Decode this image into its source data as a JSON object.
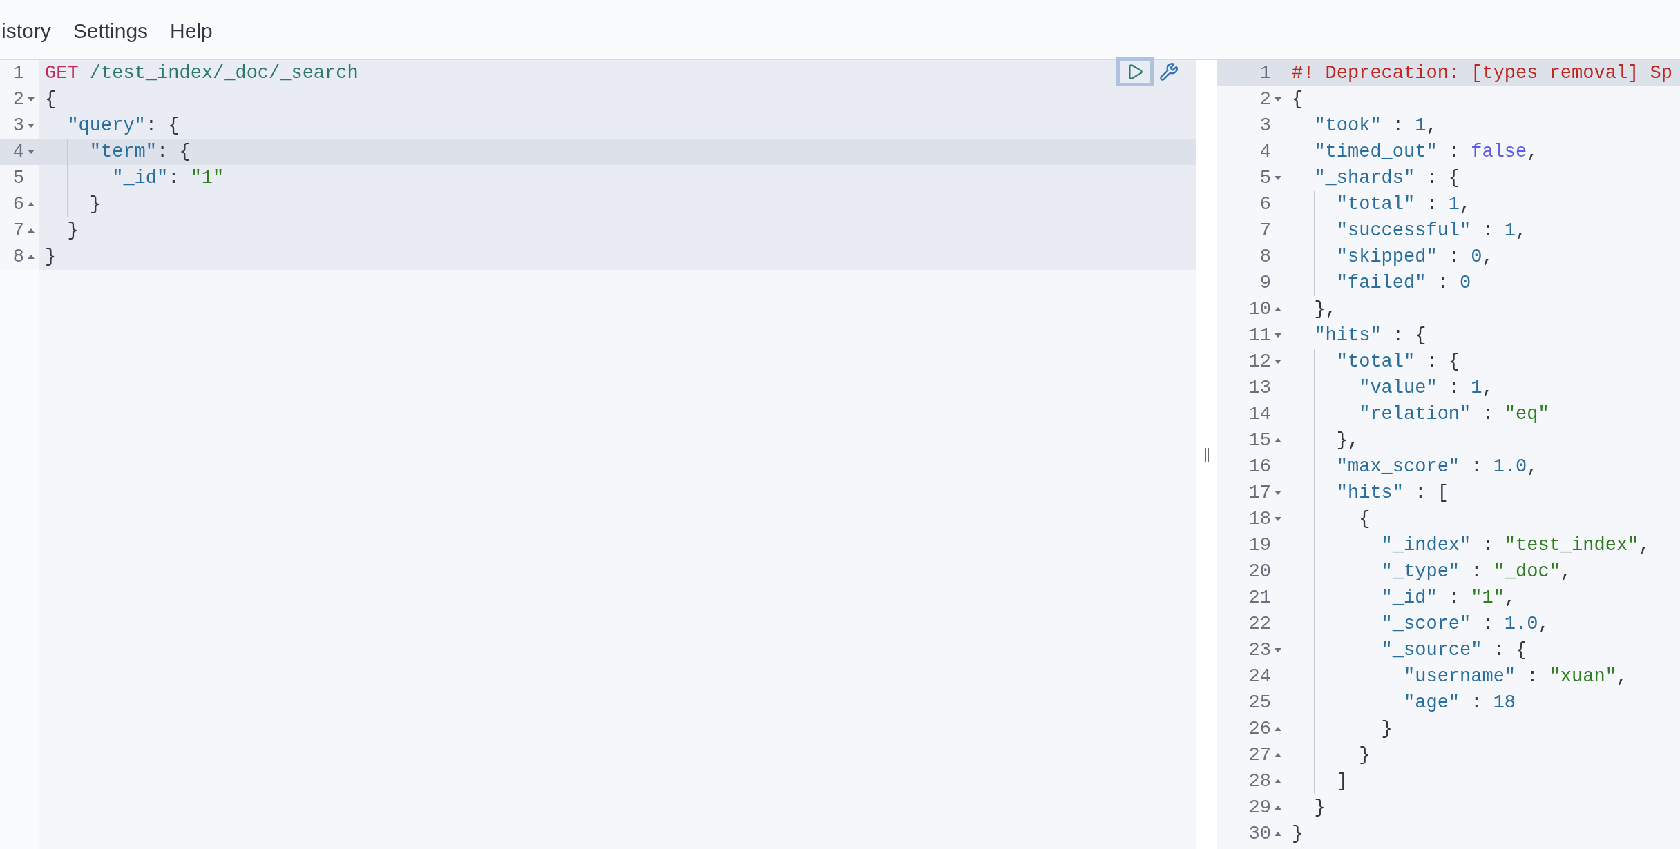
{
  "menu": [
    {
      "label": "istory"
    },
    {
      "label": "Settings"
    },
    {
      "label": "Help"
    }
  ],
  "request_editor": {
    "lines": [
      {
        "number": "1",
        "fold_start": false,
        "fold_end": false,
        "active": false,
        "highlighted": true,
        "tokens": [
          {
            "kind": "method",
            "text": "GET"
          },
          {
            "kind": "path",
            "text": " /test_index/_doc/_search"
          }
        ]
      },
      {
        "number": "2",
        "fold_start": true,
        "fold_end": false,
        "active": false,
        "highlighted": true,
        "tokens": [
          {
            "kind": "punct",
            "text": "{"
          }
        ]
      },
      {
        "number": "3",
        "fold_start": true,
        "fold_end": false,
        "active": false,
        "highlighted": true,
        "tokens": [
          {
            "kind": "key",
            "text": "  \"query\""
          },
          {
            "kind": "punct",
            "text": ": {"
          }
        ]
      },
      {
        "number": "4",
        "fold_start": true,
        "fold_end": false,
        "active": true,
        "highlighted": true,
        "tokens": [
          {
            "kind": "key",
            "text": "    \"term\""
          },
          {
            "kind": "punct",
            "text": ": {"
          }
        ]
      },
      {
        "number": "5",
        "fold_start": false,
        "fold_end": false,
        "active": false,
        "highlighted": true,
        "tokens": [
          {
            "kind": "key",
            "text": "      \"_id\""
          },
          {
            "kind": "punct",
            "text": ": "
          },
          {
            "kind": "string",
            "text": "\"1\""
          }
        ]
      },
      {
        "number": "6",
        "fold_start": false,
        "fold_end": true,
        "active": false,
        "highlighted": true,
        "tokens": [
          {
            "kind": "punct",
            "text": "    }"
          }
        ]
      },
      {
        "number": "7",
        "fold_start": false,
        "fold_end": true,
        "active": false,
        "highlighted": true,
        "tokens": [
          {
            "kind": "punct",
            "text": "  }"
          }
        ]
      },
      {
        "number": "8",
        "fold_start": false,
        "fold_end": true,
        "active": false,
        "highlighted": true,
        "tokens": [
          {
            "kind": "punct",
            "text": "}"
          }
        ]
      }
    ]
  },
  "response_viewer": {
    "lines": [
      {
        "number": "1",
        "fold_start": false,
        "fold_end": false,
        "active": true,
        "tokens": [
          {
            "kind": "comment",
            "text": "#! Deprecation: [types removal] Sp"
          }
        ]
      },
      {
        "number": "2",
        "fold_start": true,
        "fold_end": false,
        "active": false,
        "tokens": [
          {
            "kind": "punct",
            "text": "{"
          }
        ]
      },
      {
        "number": "3",
        "fold_start": false,
        "fold_end": false,
        "active": false,
        "tokens": [
          {
            "kind": "key",
            "text": "  \"took\""
          },
          {
            "kind": "punct",
            "text": " : "
          },
          {
            "kind": "number",
            "text": "1"
          },
          {
            "kind": "punct",
            "text": ","
          }
        ]
      },
      {
        "number": "4",
        "fold_start": false,
        "fold_end": false,
        "active": false,
        "tokens": [
          {
            "kind": "key",
            "text": "  \"timed_out\""
          },
          {
            "kind": "punct",
            "text": " : "
          },
          {
            "kind": "boolean",
            "text": "false"
          },
          {
            "kind": "punct",
            "text": ","
          }
        ]
      },
      {
        "number": "5",
        "fold_start": true,
        "fold_end": false,
        "active": false,
        "tokens": [
          {
            "kind": "key",
            "text": "  \"_shards\""
          },
          {
            "kind": "punct",
            "text": " : {"
          }
        ]
      },
      {
        "number": "6",
        "fold_start": false,
        "fold_end": false,
        "active": false,
        "tokens": [
          {
            "kind": "key",
            "text": "    \"total\""
          },
          {
            "kind": "punct",
            "text": " : "
          },
          {
            "kind": "number",
            "text": "1"
          },
          {
            "kind": "punct",
            "text": ","
          }
        ]
      },
      {
        "number": "7",
        "fold_start": false,
        "fold_end": false,
        "active": false,
        "tokens": [
          {
            "kind": "key",
            "text": "    \"successful\""
          },
          {
            "kind": "punct",
            "text": " : "
          },
          {
            "kind": "number",
            "text": "1"
          },
          {
            "kind": "punct",
            "text": ","
          }
        ]
      },
      {
        "number": "8",
        "fold_start": false,
        "fold_end": false,
        "active": false,
        "tokens": [
          {
            "kind": "key",
            "text": "    \"skipped\""
          },
          {
            "kind": "punct",
            "text": " : "
          },
          {
            "kind": "number",
            "text": "0"
          },
          {
            "kind": "punct",
            "text": ","
          }
        ]
      },
      {
        "number": "9",
        "fold_start": false,
        "fold_end": false,
        "active": false,
        "tokens": [
          {
            "kind": "key",
            "text": "    \"failed\""
          },
          {
            "kind": "punct",
            "text": " : "
          },
          {
            "kind": "number",
            "text": "0"
          }
        ]
      },
      {
        "number": "10",
        "fold_start": false,
        "fold_end": true,
        "active": false,
        "tokens": [
          {
            "kind": "punct",
            "text": "  },"
          }
        ]
      },
      {
        "number": "11",
        "fold_start": true,
        "fold_end": false,
        "active": false,
        "tokens": [
          {
            "kind": "key",
            "text": "  \"hits\""
          },
          {
            "kind": "punct",
            "text": " : {"
          }
        ]
      },
      {
        "number": "12",
        "fold_start": true,
        "fold_end": false,
        "active": false,
        "tokens": [
          {
            "kind": "key",
            "text": "    \"total\""
          },
          {
            "kind": "punct",
            "text": " : {"
          }
        ]
      },
      {
        "number": "13",
        "fold_start": false,
        "fold_end": false,
        "active": false,
        "tokens": [
          {
            "kind": "key",
            "text": "      \"value\""
          },
          {
            "kind": "punct",
            "text": " : "
          },
          {
            "kind": "number",
            "text": "1"
          },
          {
            "kind": "punct",
            "text": ","
          }
        ]
      },
      {
        "number": "14",
        "fold_start": false,
        "fold_end": false,
        "active": false,
        "tokens": [
          {
            "kind": "key",
            "text": "      \"relation\""
          },
          {
            "kind": "punct",
            "text": " : "
          },
          {
            "kind": "string",
            "text": "\"eq\""
          }
        ]
      },
      {
        "number": "15",
        "fold_start": false,
        "fold_end": true,
        "active": false,
        "tokens": [
          {
            "kind": "punct",
            "text": "    },"
          }
        ]
      },
      {
        "number": "16",
        "fold_start": false,
        "fold_end": false,
        "active": false,
        "tokens": [
          {
            "kind": "key",
            "text": "    \"max_score\""
          },
          {
            "kind": "punct",
            "text": " : "
          },
          {
            "kind": "number",
            "text": "1.0"
          },
          {
            "kind": "punct",
            "text": ","
          }
        ]
      },
      {
        "number": "17",
        "fold_start": true,
        "fold_end": false,
        "active": false,
        "tokens": [
          {
            "kind": "key",
            "text": "    \"hits\""
          },
          {
            "kind": "punct",
            "text": " : ["
          }
        ]
      },
      {
        "number": "18",
        "fold_start": true,
        "fold_end": false,
        "active": false,
        "tokens": [
          {
            "kind": "punct",
            "text": "      {"
          }
        ]
      },
      {
        "number": "19",
        "fold_start": false,
        "fold_end": false,
        "active": false,
        "tokens": [
          {
            "kind": "key",
            "text": "        \"_index\""
          },
          {
            "kind": "punct",
            "text": " : "
          },
          {
            "kind": "string",
            "text": "\"test_index\""
          },
          {
            "kind": "punct",
            "text": ","
          }
        ]
      },
      {
        "number": "20",
        "fold_start": false,
        "fold_end": false,
        "active": false,
        "tokens": [
          {
            "kind": "key",
            "text": "        \"_type\""
          },
          {
            "kind": "punct",
            "text": " : "
          },
          {
            "kind": "string",
            "text": "\"_doc\""
          },
          {
            "kind": "punct",
            "text": ","
          }
        ]
      },
      {
        "number": "21",
        "fold_start": false,
        "fold_end": false,
        "active": false,
        "tokens": [
          {
            "kind": "key",
            "text": "        \"_id\""
          },
          {
            "kind": "punct",
            "text": " : "
          },
          {
            "kind": "string",
            "text": "\"1\""
          },
          {
            "kind": "punct",
            "text": ","
          }
        ]
      },
      {
        "number": "22",
        "fold_start": false,
        "fold_end": false,
        "active": false,
        "tokens": [
          {
            "kind": "key",
            "text": "        \"_score\""
          },
          {
            "kind": "punct",
            "text": " : "
          },
          {
            "kind": "number",
            "text": "1.0"
          },
          {
            "kind": "punct",
            "text": ","
          }
        ]
      },
      {
        "number": "23",
        "fold_start": true,
        "fold_end": false,
        "active": false,
        "tokens": [
          {
            "kind": "key",
            "text": "        \"_source\""
          },
          {
            "kind": "punct",
            "text": " : {"
          }
        ]
      },
      {
        "number": "24",
        "fold_start": false,
        "fold_end": false,
        "active": false,
        "tokens": [
          {
            "kind": "key",
            "text": "          \"username\""
          },
          {
            "kind": "punct",
            "text": " : "
          },
          {
            "kind": "string",
            "text": "\"xuan\""
          },
          {
            "kind": "punct",
            "text": ","
          }
        ]
      },
      {
        "number": "25",
        "fold_start": false,
        "fold_end": false,
        "active": false,
        "tokens": [
          {
            "kind": "key",
            "text": "          \"age\""
          },
          {
            "kind": "punct",
            "text": " : "
          },
          {
            "kind": "number",
            "text": "18"
          }
        ]
      },
      {
        "number": "26",
        "fold_start": false,
        "fold_end": true,
        "active": false,
        "tokens": [
          {
            "kind": "punct",
            "text": "        }"
          }
        ]
      },
      {
        "number": "27",
        "fold_start": false,
        "fold_end": true,
        "active": false,
        "tokens": [
          {
            "kind": "punct",
            "text": "      }"
          }
        ]
      },
      {
        "number": "28",
        "fold_start": false,
        "fold_end": true,
        "active": false,
        "tokens": [
          {
            "kind": "punct",
            "text": "    ]"
          }
        ]
      },
      {
        "number": "29",
        "fold_start": false,
        "fold_end": true,
        "active": false,
        "tokens": [
          {
            "kind": "punct",
            "text": "  }"
          }
        ]
      },
      {
        "number": "30",
        "fold_start": false,
        "fold_end": true,
        "active": false,
        "tokens": [
          {
            "kind": "punct",
            "text": "}"
          }
        ]
      }
    ]
  }
}
